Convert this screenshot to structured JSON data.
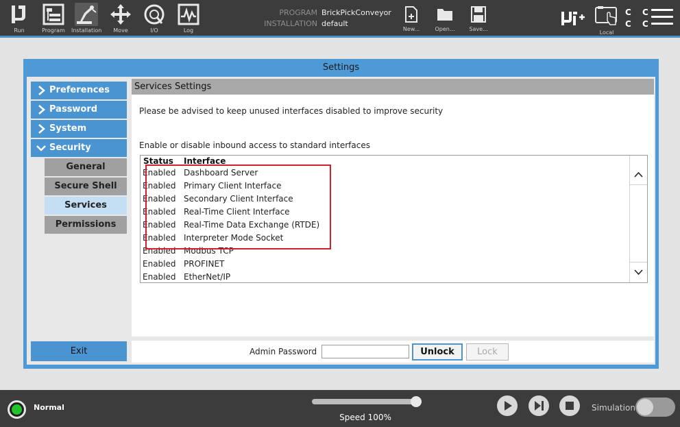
{
  "topbar": {
    "nav": [
      {
        "id": "run",
        "label": "Run",
        "icon": "ur-logo-icon"
      },
      {
        "id": "program",
        "label": "Program",
        "icon": "program-tree-icon"
      },
      {
        "id": "installation",
        "label": "Installation",
        "icon": "robot-arm-icon"
      },
      {
        "id": "move",
        "label": "Move",
        "icon": "move-arrows-icon"
      },
      {
        "id": "io",
        "label": "I/O",
        "icon": "io-gauge-icon"
      },
      {
        "id": "log",
        "label": "Log",
        "icon": "log-graph-icon"
      }
    ],
    "program_label": "PROGRAM",
    "program_value": "BrickPickConveyor",
    "installation_label": "INSTALLATION",
    "installation_value": "default",
    "file": [
      {
        "id": "new",
        "label": "New...",
        "icon": "new-file-icon"
      },
      {
        "id": "open",
        "label": "Open...",
        "icon": "folder-icon"
      },
      {
        "id": "save",
        "label": "Save...",
        "icon": "save-icon"
      }
    ],
    "local_label": "Local",
    "cc_text": "C C\nC C"
  },
  "dialog": {
    "title": "Settings",
    "sidebar": {
      "items": [
        {
          "label": "Preferences",
          "expanded": false
        },
        {
          "label": "Password",
          "expanded": false
        },
        {
          "label": "System",
          "expanded": false
        },
        {
          "label": "Security",
          "expanded": true
        }
      ],
      "subitems": [
        {
          "label": "General",
          "selected": false
        },
        {
          "label": "Secure Shell",
          "selected": false
        },
        {
          "label": "Services",
          "selected": true
        },
        {
          "label": "Permissions",
          "selected": false
        }
      ],
      "exit_label": "Exit"
    },
    "main": {
      "heading": "Services Settings",
      "advice": "Please be advised to keep unused interfaces disabled to improve security",
      "enable_text": "Enable or disable inbound access to standard interfaces",
      "columns": [
        "Status",
        "Interface"
      ],
      "rows": [
        {
          "status": "Enabled",
          "interface": "Dashboard Server"
        },
        {
          "status": "Enabled",
          "interface": "Primary Client Interface"
        },
        {
          "status": "Enabled",
          "interface": "Secondary Client Interface"
        },
        {
          "status": "Enabled",
          "interface": "Real-Time Client Interface"
        },
        {
          "status": "Enabled",
          "interface": "Real-Time Data Exchange (RTDE)"
        },
        {
          "status": "Enabled",
          "interface": "Interpreter Mode Socket"
        },
        {
          "status": "Enabled",
          "interface": "Modbus TCP"
        },
        {
          "status": "Enabled",
          "interface": "PROFINET"
        },
        {
          "status": "Enabled",
          "interface": "EtherNet/IP"
        }
      ],
      "highlight_color": "#d0202c"
    },
    "password": {
      "label": "Admin Password",
      "value": "",
      "unlock_label": "Unlock",
      "lock_label": "Lock"
    }
  },
  "footer": {
    "status": "Normal",
    "status_color": "#22c32b",
    "speed_label": "Speed 100%",
    "speed_value": 1.0,
    "simulation_label": "Simulation",
    "simulation_on": false
  },
  "colors": {
    "accent": "#4a94d2",
    "topbar": "#3c3c3c"
  }
}
